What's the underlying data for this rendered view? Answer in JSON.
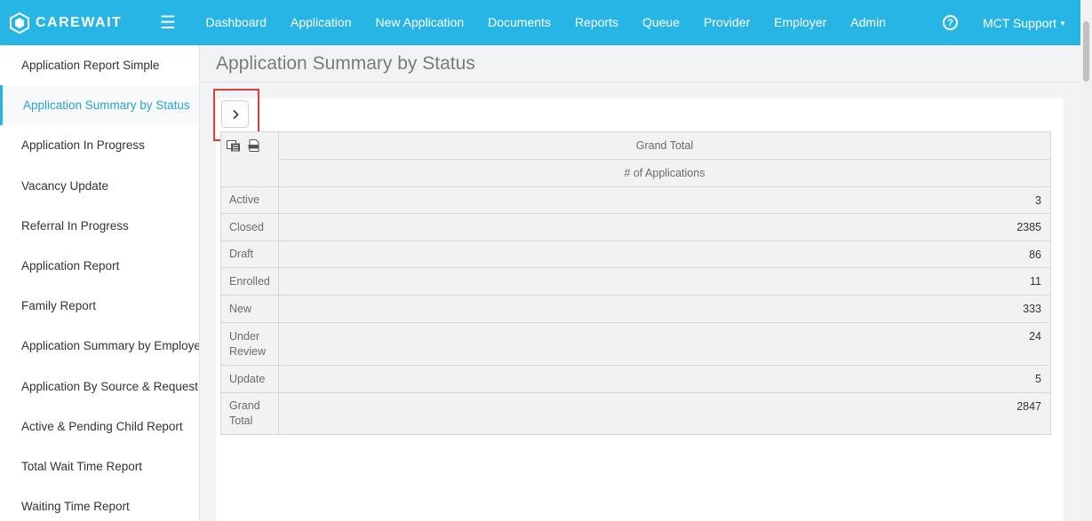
{
  "brand": {
    "name": "CAREWAIT"
  },
  "nav": {
    "items": [
      "Dashboard",
      "Application",
      "New Application",
      "Documents",
      "Reports",
      "Queue",
      "Provider",
      "Employer",
      "Admin"
    ]
  },
  "user": {
    "label": "MCT Support"
  },
  "sidebar": {
    "items": [
      "Application Report Simple",
      "Application Summary by Status",
      "Application In Progress",
      "Vacancy Update",
      "Referral In Progress",
      "Application Report",
      "Family Report",
      "Application Summary by Employer",
      "Application By Source & Request Date",
      "Active & Pending Child Report",
      "Total Wait Time Report",
      "Waiting Time Report"
    ],
    "active_index": 1
  },
  "page": {
    "title": "Application Summary by Status"
  },
  "pivot": {
    "column_group": "Grand Total",
    "measure": "# of Applications",
    "rows": [
      {
        "label": "Active",
        "value": "3"
      },
      {
        "label": "Closed",
        "value": "2385"
      },
      {
        "label": "Draft",
        "value": "86"
      },
      {
        "label": "Enrolled",
        "value": "11"
      },
      {
        "label": "New",
        "value": "333"
      },
      {
        "label": "Under Review",
        "value": "24"
      },
      {
        "label": "Update",
        "value": "5"
      },
      {
        "label": "Grand Total",
        "value": "2847"
      }
    ]
  },
  "icons": {
    "toggle": "chevron-right-icon",
    "help": "question-circle-icon",
    "export_excel": "spreadsheet-export-icon",
    "export_other": "document-export-icon"
  },
  "colors": {
    "header": "#27b5e6",
    "active_link": "#27a3d6",
    "highlight": "#e03c3c"
  }
}
